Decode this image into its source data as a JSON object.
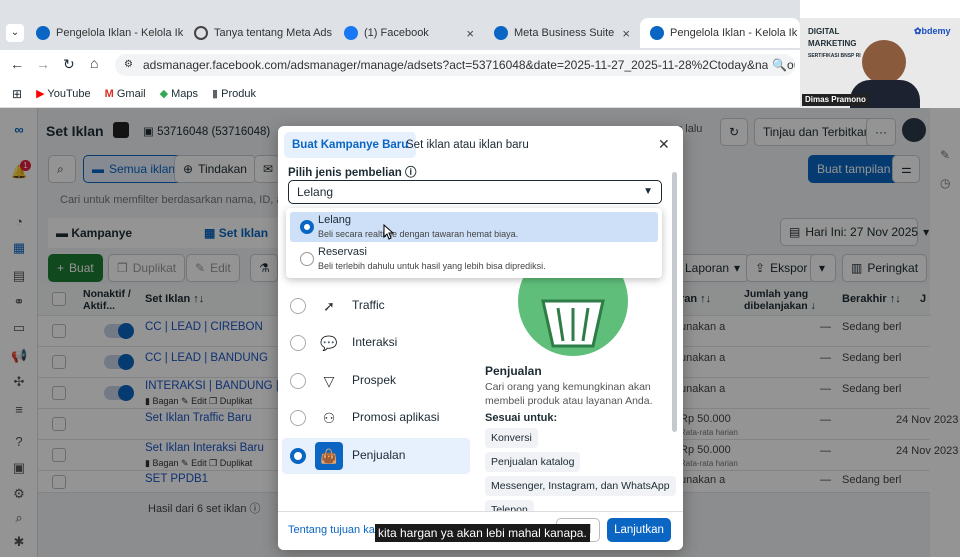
{
  "browser": {
    "tabs": [
      {
        "label": "Pengelola Iklan - Kelola Ik",
        "icon": "meta-icon"
      },
      {
        "label": "Tanya tentang Meta Ads",
        "icon": "globe-icon"
      },
      {
        "label": "(1) Facebook",
        "icon": "facebook-icon"
      },
      {
        "label": "Meta Business Suite",
        "icon": "meta-icon"
      },
      {
        "label": "Pengelola Iklan - Kelola Ik",
        "icon": "meta-icon"
      }
    ],
    "url": "adsmanager.facebook.com/adsmanager/manage/adsets?act=53716048&date=2025-11-27_2025-11-28%2Ctoday&nav_source=fb...",
    "bookmarks": [
      "YouTube",
      "Gmail",
      "Maps",
      "Produk"
    ]
  },
  "webcam": {
    "line1": "DIGITAL",
    "line2": "MARKETING",
    "line3": "SERTIFIKASI BNSP RI",
    "brand": "bdemy",
    "name": "Dimas Pramono"
  },
  "header": {
    "title": "Set Iklan",
    "account": "53716048 (53716048)",
    "updated": "ng lalu",
    "review_button": "Tinjau dan Terbitkan",
    "more": "···"
  },
  "toolbar": {
    "all_ads": "Semua iklan",
    "actions": "Tindakan",
    "search_placeholder": "Cari untuk memfilter berdasarkan nama, ID, atau m",
    "create_view": "Buat tampilan",
    "date": "Hari Ini: 27 Nov 2025",
    "campaign_tab": "Kampanye",
    "adset_tab": "Set Iklan",
    "create": "Buat",
    "duplicate": "Duplikat",
    "edit": "Edit",
    "reports": "Laporan",
    "export": "Ekspor",
    "summary": "Peringkat"
  },
  "table": {
    "headers": [
      "Nonaktif / Aktif...",
      "Set Iklan ↑↓",
      "ran ↑↓",
      "Jumlah yang dibelanjakan ↓",
      "Berakhir ↑↓",
      "J"
    ],
    "rows": [
      {
        "name": "CC | LEAD | CIREBON",
        "c1": "unakan a",
        "c2": "—",
        "c3": "Sedang berl"
      },
      {
        "name": "CC | LEAD | BANDUNG",
        "c1": "unakan a",
        "c2": "—",
        "c3": "Sedang berl"
      },
      {
        "name": "INTERAKSI | BANDUNG | CHIS",
        "c1": "unakan a",
        "c2": "—",
        "c3": "Sedang berl"
      },
      {
        "name": "Set Iklan Traffic Baru",
        "c1": "Rp 50.000",
        "c2": "—",
        "c3": "24 Nov 2023"
      },
      {
        "name": "Set Iklan Interaksi Baru",
        "c1": "Rp 50.000",
        "c2": "—",
        "c3": "24 Nov 2023"
      },
      {
        "name": "SET PPDB1",
        "c1": "unakan a",
        "c2": "—",
        "c3": "Sedang berl"
      }
    ],
    "row_actions": [
      "Bagan",
      "Edit",
      "Duplikat"
    ],
    "daily_note": "Rata-rata harian",
    "footer": "Hasil dari 6 set iklan"
  },
  "modal": {
    "tab_new": "Buat Kampanye Baru",
    "tab_existing": "Set iklan atau iklan baru",
    "purchase_label": "Pilih jenis pembelian",
    "purchase_value": "Lelang",
    "options": [
      {
        "title": "Lelang",
        "desc": "Beli secara realtime dengan tawaran hemat biaya.",
        "selected": true
      },
      {
        "title": "Reservasi",
        "desc": "Beli terlebih dahulu untuk hasil yang lebih bisa diprediksi.",
        "selected": false
      }
    ],
    "objectives": [
      {
        "label": "Traffic",
        "icon": "cursor-icon",
        "selected": false
      },
      {
        "label": "Interaksi",
        "icon": "chat-icon",
        "selected": false
      },
      {
        "label": "Prospek",
        "icon": "funnel-icon",
        "selected": false
      },
      {
        "label": "Promosi aplikasi",
        "icon": "people-icon",
        "selected": false
      },
      {
        "label": "Penjualan",
        "icon": "bag-icon",
        "selected": true
      }
    ],
    "detail_title": "Penjualan",
    "detail_desc": "Cari orang yang kemungkinan akan membeli produk atau layanan Anda.",
    "suited_label": "Sesuai untuk:",
    "chips": [
      "Konversi",
      "Penjualan katalog",
      "Messenger, Instagram, dan WhatsApp",
      "Telepon"
    ],
    "about_link": "Tentang tujuan kam",
    "cancel": "Batal",
    "continue": "Lanjutkan"
  },
  "subtitle": "kita hargan ya akan lebi mahal kanapa."
}
